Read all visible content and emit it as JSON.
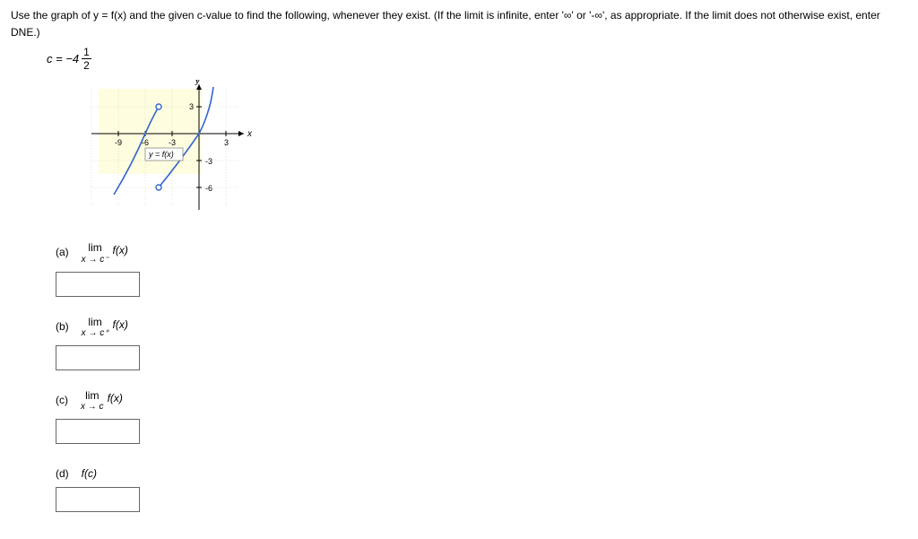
{
  "instructions": "Use the graph of y = f(x) and the given c-value to find the following, whenever they exist. (If the limit is infinite, enter '∞' or '-∞', as appropriate. If the limit does not otherwise exist, enter DNE.)",
  "c_value": {
    "prefix": "c = −4",
    "numerator": "1",
    "denominator": "2"
  },
  "chart_data": {
    "type": "line",
    "title": "",
    "xlabel": "x",
    "ylabel": "y",
    "xlim": [
      -10,
      4
    ],
    "ylim": [
      -7,
      5
    ],
    "x_ticks": [
      -9,
      -6,
      -3,
      3
    ],
    "y_ticks": [
      -6,
      -3,
      3
    ],
    "curve_label": "y = f(x)",
    "curve_label_pos": [
      -5,
      -2.3
    ],
    "series": [
      {
        "name": "f(x)",
        "segments": [
          {
            "points": [
              [
                -9.5,
                -6.8
              ],
              [
                -9,
                -6
              ],
              [
                -8,
                -3.2
              ],
              [
                -7,
                -1.0
              ],
              [
                -6.0,
                1.0
              ],
              [
                -5.2,
                2.4
              ],
              [
                -4.8,
                2.85
              ],
              [
                -4.5,
                3
              ]
            ],
            "end_open": true,
            "end_open_point": [
              -4.5,
              3
            ]
          },
          {
            "points": [
              [
                -4.5,
                -6
              ],
              [
                -4.0,
                -5.6
              ],
              [
                -3.0,
                -4.4
              ],
              [
                -2.0,
                -3.1
              ],
              [
                -1.0,
                -1.6
              ],
              [
                0,
                0
              ],
              [
                0.6,
                1.3
              ],
              [
                1.0,
                2.5
              ],
              [
                1.3,
                3.6
              ],
              [
                1.5,
                4.8
              ]
            ],
            "start_open": true,
            "start_open_point": [
              -4.5,
              -6
            ]
          }
        ]
      }
    ],
    "markers": [
      {
        "x": -4.5,
        "y": 3,
        "style": "open"
      },
      {
        "x": -4.5,
        "y": -6,
        "style": "open"
      }
    ],
    "highlight_rect": {
      "x": [
        -9.5,
        0
      ],
      "y": [
        -4,
        4
      ],
      "color": "#fffde0"
    }
  },
  "parts": {
    "a": {
      "label": "(a)",
      "lim_top": "lim",
      "lim_bot_html": "x → c⁻",
      "fx": "f(x)",
      "value": ""
    },
    "b": {
      "label": "(b)",
      "lim_top": "lim",
      "lim_bot_html": "x → c⁺",
      "fx": "f(x)",
      "value": ""
    },
    "c": {
      "label": "(c)",
      "lim_top": "lim",
      "lim_bot_html": "x → c",
      "fx": "f(x)",
      "value": ""
    },
    "d": {
      "label": "(d)",
      "expr": "f(c)",
      "value": ""
    }
  }
}
